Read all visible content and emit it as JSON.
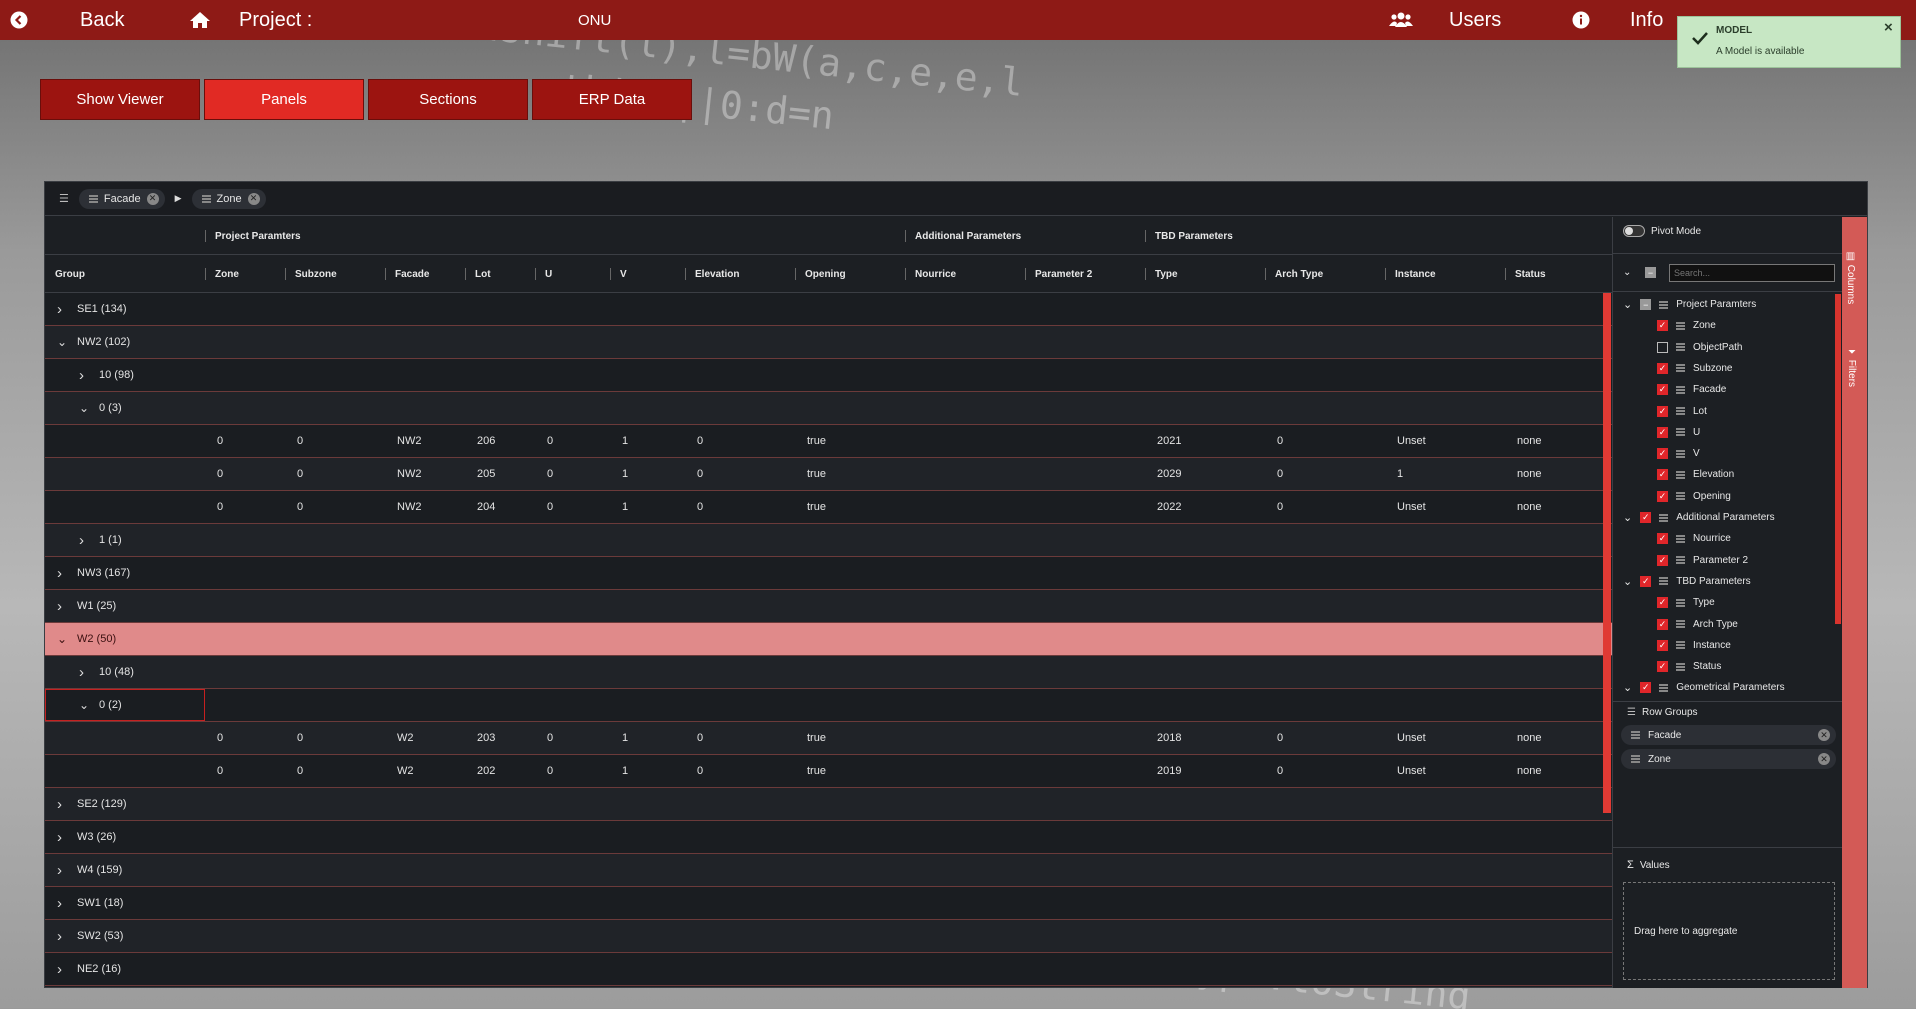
{
  "topbar": {
    "back_label": "Back",
    "project_label": "Project :",
    "project_name": "ONU",
    "users_label": "Users",
    "info_label": "Info"
  },
  "toast": {
    "title": "MODEL",
    "message": "A Model is available",
    "close": "×"
  },
  "nav": [
    {
      "label": "Show Viewer",
      "active": false
    },
    {
      "label": "Panels",
      "active": true
    },
    {
      "label": "Sections",
      "active": false
    },
    {
      "label": "ERP Data",
      "active": false
    }
  ],
  "grid": {
    "group_chips": [
      "Facade",
      "Zone"
    ],
    "header_groups": {
      "project": "Project Paramters",
      "additional": "Additional Parameters",
      "tbd": "TBD Parameters"
    },
    "columns": [
      "Group",
      "Zone",
      "Subzone",
      "Facade",
      "Lot",
      "U",
      "V",
      "Elevation",
      "Opening",
      "Nourrice",
      "Parameter 2",
      "Type",
      "Arch Type",
      "Instance",
      "Status"
    ],
    "rows": [
      {
        "kind": "group",
        "level": 0,
        "expanded": false,
        "label": "SE1 (134)"
      },
      {
        "kind": "group",
        "level": 0,
        "expanded": true,
        "label": "NW2 (102)"
      },
      {
        "kind": "group",
        "level": 1,
        "expanded": false,
        "label": "10 (98)"
      },
      {
        "kind": "group",
        "level": 1,
        "expanded": true,
        "label": "0 (3)"
      },
      {
        "kind": "data",
        "values": [
          "0",
          "0",
          "NW2",
          "206",
          "0",
          "1",
          "0",
          "true",
          "",
          "",
          "2021",
          "0",
          "Unset",
          "none"
        ]
      },
      {
        "kind": "data",
        "values": [
          "0",
          "0",
          "NW2",
          "205",
          "0",
          "1",
          "0",
          "true",
          "",
          "",
          "2029",
          "0",
          "1",
          "none"
        ]
      },
      {
        "kind": "data",
        "values": [
          "0",
          "0",
          "NW2",
          "204",
          "0",
          "1",
          "0",
          "true",
          "",
          "",
          "2022",
          "0",
          "Unset",
          "none"
        ]
      },
      {
        "kind": "group",
        "level": 1,
        "expanded": false,
        "label": "1 (1)"
      },
      {
        "kind": "group",
        "level": 0,
        "expanded": false,
        "label": "NW3 (167)"
      },
      {
        "kind": "group",
        "level": 0,
        "expanded": false,
        "label": "W1 (25)"
      },
      {
        "kind": "group",
        "level": 0,
        "expanded": true,
        "label": "W2 (50)",
        "selected": true
      },
      {
        "kind": "group",
        "level": 1,
        "expanded": false,
        "label": "10 (48)"
      },
      {
        "kind": "group",
        "level": 1,
        "expanded": true,
        "label": "0 (2)",
        "focused": true
      },
      {
        "kind": "data",
        "values": [
          "0",
          "0",
          "W2",
          "203",
          "0",
          "1",
          "0",
          "true",
          "",
          "",
          "2018",
          "0",
          "Unset",
          "none"
        ]
      },
      {
        "kind": "data",
        "values": [
          "0",
          "0",
          "W2",
          "202",
          "0",
          "1",
          "0",
          "true",
          "",
          "",
          "2019",
          "0",
          "Unset",
          "none"
        ]
      },
      {
        "kind": "group",
        "level": 0,
        "expanded": false,
        "label": "SE2 (129)"
      },
      {
        "kind": "group",
        "level": 0,
        "expanded": false,
        "label": "W3 (26)"
      },
      {
        "kind": "group",
        "level": 0,
        "expanded": false,
        "label": "W4 (159)"
      },
      {
        "kind": "group",
        "level": 0,
        "expanded": false,
        "label": "SW1 (18)"
      },
      {
        "kind": "group",
        "level": 0,
        "expanded": false,
        "label": "SW2 (53)"
      },
      {
        "kind": "group",
        "level": 0,
        "expanded": false,
        "label": "NE2 (16)"
      }
    ]
  },
  "sidepanel": {
    "pivot_label": "Pivot Mode",
    "search_placeholder": "Search...",
    "tab_columns": "Columns",
    "tab_filters": "Filters",
    "tree": [
      {
        "level": 0,
        "label": "Project Paramters",
        "state": "mid",
        "group": true
      },
      {
        "level": 1,
        "label": "Zone",
        "state": "on"
      },
      {
        "level": 1,
        "label": "ObjectPath",
        "state": "off"
      },
      {
        "level": 1,
        "label": "Subzone",
        "state": "on"
      },
      {
        "level": 1,
        "label": "Facade",
        "state": "on"
      },
      {
        "level": 1,
        "label": "Lot",
        "state": "on"
      },
      {
        "level": 1,
        "label": "U",
        "state": "on"
      },
      {
        "level": 1,
        "label": "V",
        "state": "on"
      },
      {
        "level": 1,
        "label": "Elevation",
        "state": "on"
      },
      {
        "level": 1,
        "label": "Opening",
        "state": "on"
      },
      {
        "level": 0,
        "label": "Additional Parameters",
        "state": "on",
        "group": true
      },
      {
        "level": 1,
        "label": "Nourrice",
        "state": "on"
      },
      {
        "level": 1,
        "label": "Parameter 2",
        "state": "on"
      },
      {
        "level": 0,
        "label": "TBD Parameters",
        "state": "on",
        "group": true
      },
      {
        "level": 1,
        "label": "Type",
        "state": "on"
      },
      {
        "level": 1,
        "label": "Arch Type",
        "state": "on"
      },
      {
        "level": 1,
        "label": "Instance",
        "state": "on"
      },
      {
        "level": 1,
        "label": "Status",
        "state": "on"
      },
      {
        "level": 0,
        "label": "Geometrical Parameters",
        "state": "on",
        "group": true
      }
    ],
    "row_groups_label": "Row Groups",
    "row_groups": [
      "Facade",
      "Zone"
    ],
    "values_label": "Values",
    "aggregate_hint": "Drag here to aggregate"
  }
}
